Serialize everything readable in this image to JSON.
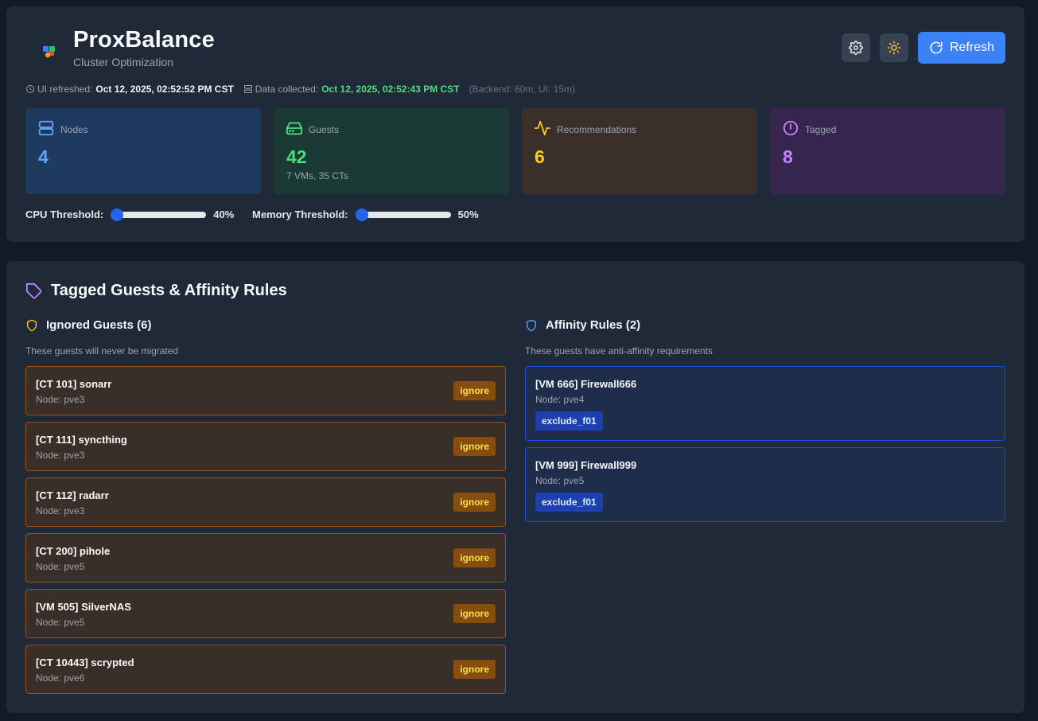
{
  "header": {
    "title": "ProxBalance",
    "subtitle": "Cluster Optimization",
    "refresh_label": "Refresh",
    "ui_refreshed_label": "UI refreshed:",
    "ui_refreshed_value": "Oct 12, 2025, 02:52:52 PM CST",
    "data_collected_label": "Data collected:",
    "data_collected_value": "Oct 12, 2025, 02:52:43 PM CST",
    "intervals": "(Backend: 60m, UI: 15m)"
  },
  "stats": {
    "nodes": {
      "label": "Nodes",
      "value": "4"
    },
    "guests": {
      "label": "Guests",
      "value": "42",
      "sub": "7 VMs, 35 CTs"
    },
    "recommendations": {
      "label": "Recommendations",
      "value": "6"
    },
    "tagged": {
      "label": "Tagged",
      "value": "8"
    }
  },
  "thresholds": {
    "cpu": {
      "label": "CPU Threshold:",
      "value_text": "40%",
      "value": 0.4
    },
    "memory": {
      "label": "Memory Threshold:",
      "value_text": "50%",
      "value": 0.5
    }
  },
  "tagged_section": {
    "title": "Tagged Guests & Affinity Rules",
    "ignored": {
      "title": "Ignored Guests (6)",
      "description": "These guests will never be migrated",
      "items": [
        {
          "name": "[CT 101] sonarr",
          "node": "Node: pve3",
          "tag": "ignore"
        },
        {
          "name": "[CT 111] syncthing",
          "node": "Node: pve3",
          "tag": "ignore"
        },
        {
          "name": "[CT 112] radarr",
          "node": "Node: pve3",
          "tag": "ignore"
        },
        {
          "name": "[CT 200] pihole",
          "node": "Node: pve5",
          "tag": "ignore"
        },
        {
          "name": "[VM 505] SilverNAS",
          "node": "Node: pve5",
          "tag": "ignore"
        },
        {
          "name": "[CT 10443] scrypted",
          "node": "Node: pve6",
          "tag": "ignore"
        }
      ]
    },
    "affinity": {
      "title": "Affinity Rules (2)",
      "description": "These guests have anti-affinity requirements",
      "items": [
        {
          "name": "[VM 666] Firewall666",
          "node": "Node: pve4",
          "tag": "exclude_f01"
        },
        {
          "name": "[VM 999] Firewall999",
          "node": "Node: pve5",
          "tag": "exclude_f01"
        }
      ]
    }
  },
  "colors": {
    "accent": "#3b82f6",
    "nodes": "#60a5fa",
    "guests": "#4ade80",
    "recommendations": "#facc15",
    "tagged": "#c084fc"
  }
}
